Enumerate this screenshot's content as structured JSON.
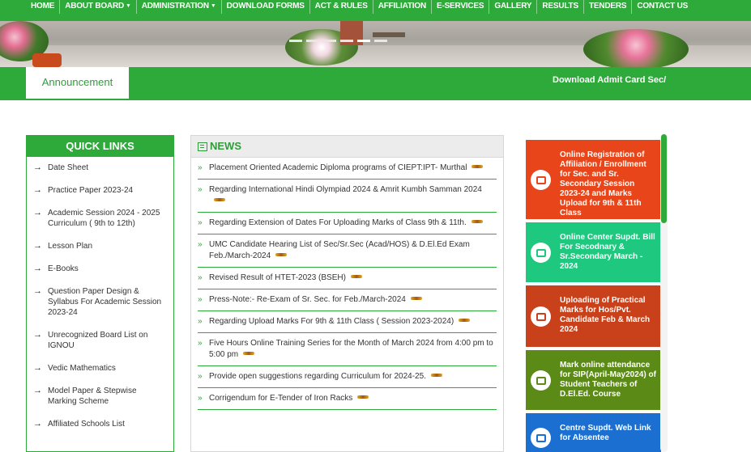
{
  "nav": {
    "items": [
      {
        "label": "HOME",
        "caret": false
      },
      {
        "label": "ABOUT BOARD",
        "caret": true
      },
      {
        "label": "ADMINISTRATION",
        "caret": true
      },
      {
        "label": "DOWNLOAD FORMS",
        "caret": false
      },
      {
        "label": "ACT & RULES",
        "caret": false
      },
      {
        "label": "AFFILIATION",
        "caret": false
      },
      {
        "label": "E-SERVICES",
        "caret": false
      },
      {
        "label": "GALLERY",
        "caret": false
      },
      {
        "label": "RESULTS",
        "caret": false
      },
      {
        "label": "TENDERS",
        "caret": false
      },
      {
        "label": "CONTACT US",
        "caret": false
      }
    ]
  },
  "announcement": {
    "tab_label": "Announcement",
    "marquee_text": "Download Admit Card Sec/Sr.Sec"
  },
  "quick_links": {
    "title": "QUICK LINKS",
    "items": [
      "Date Sheet",
      "Practice Paper 2023-24",
      "Academic Session 2024 - 2025 Curriculum ( 9th to 12th)",
      "Lesson Plan",
      "E-Books",
      "Question Paper Design & Syllabus For Academic Session 2023-24",
      "Unrecognized Board List on IGNOU",
      "Vedic Mathematics",
      "Model Paper & Stepwise Marking Scheme",
      "Affiliated Schools List"
    ]
  },
  "news": {
    "title": "NEWS",
    "items": [
      "Placement Oriented Academic Diploma programs of CIEPT:IPT- Murthal",
      "Regarding International Hindi Olympiad 2024 & Amrit Kumbh Samman 2024",
      "Regarding Extension of Dates For Uploading Marks of Class 9th & 11th.",
      "UMC Candidate Hearing List of Sec/Sr.Sec (Acad/HOS) & D.El.Ed Exam Feb./March-2024",
      "Revised Result of HTET-2023 (BSEH)",
      "Press-Note:- Re-Exam of Sr. Sec. for Feb./March-2024",
      "Regarding Upload Marks For 9th & 11th Class ( Session 2023-2024)",
      "Five Hours Online Training Series for the Month of March 2024 from 4:00 pm to 5:00 pm",
      "Provide open suggestions regarding Curriculum for 2024-25.",
      "Corrigendum for E-Tender of Iron Racks"
    ]
  },
  "cards": [
    {
      "text": "Online Registration of Affiliation / Enrollment for Sec. and Sr. Secondary Session 2023-24 and Marks Upload for 9th & 11th Class",
      "color": "#e8451a",
      "icon": "id-card-icon"
    },
    {
      "text": "Online Center Supdt. Bill For Secodnary & Sr.Secondary March - 2024",
      "color": "#1fc87f",
      "icon": "id-card-icon"
    },
    {
      "text": "Uploading of Practical Marks for Hos/Pvt. Candidate Feb & March 2024",
      "color": "#c8411a",
      "icon": "contact-book-icon"
    },
    {
      "text": "Mark online attendance for SIP(April-May2024) of Student Teachers of D.El.Ed. Course",
      "color": "#5b8a16",
      "icon": "list-icon"
    },
    {
      "text": "Centre Supdt. Web Link for Absentee",
      "color": "#1b6fd1",
      "icon": "menu-icon"
    }
  ],
  "colors": {
    "accent": "#2eaa3a"
  }
}
